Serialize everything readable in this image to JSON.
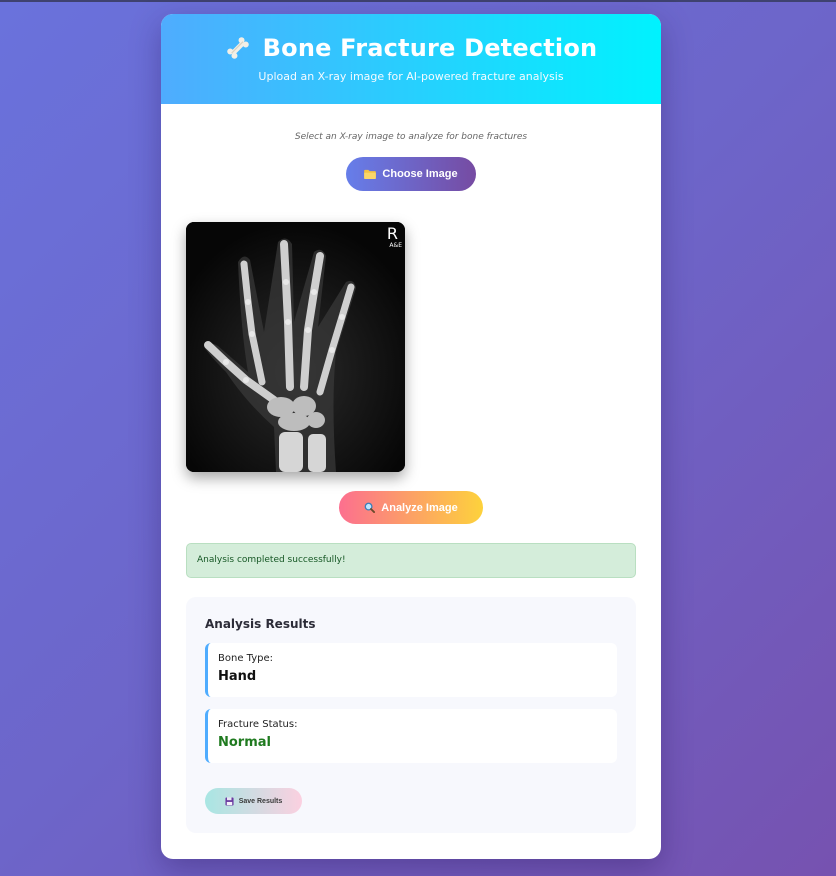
{
  "app": {
    "title": "Bone Fracture Detection",
    "subtitle": "Upload an X-ray image for AI-powered fracture analysis",
    "title_icon": "bone-icon"
  },
  "upload": {
    "instruction": "Select an X-ray image to analyze for bone fractures",
    "choose_label": "Choose Image",
    "choose_icon": "folder-icon"
  },
  "preview": {
    "marker": "R",
    "marker_sub": "A&E"
  },
  "analyze": {
    "label": "Analyze Image",
    "icon": "magnifier-icon"
  },
  "status": {
    "message": "Analysis completed successfully!"
  },
  "results": {
    "title": "Analysis Results",
    "bone_type_label": "Bone Type:",
    "bone_type_value": "Hand",
    "fracture_label": "Fracture Status:",
    "fracture_value": "Normal",
    "save_label": "Save Results",
    "save_icon": "floppy-disk-icon"
  },
  "colors": {
    "header_gradient": [
      "#4facfe",
      "#00f2fe"
    ],
    "choose_gradient": [
      "#667eea",
      "#764ba2"
    ],
    "analyze_gradient": [
      "#fc6f8f",
      "#fdd23c"
    ],
    "success_bg": "#d4edda",
    "normal_text": "#1f7a1f"
  }
}
